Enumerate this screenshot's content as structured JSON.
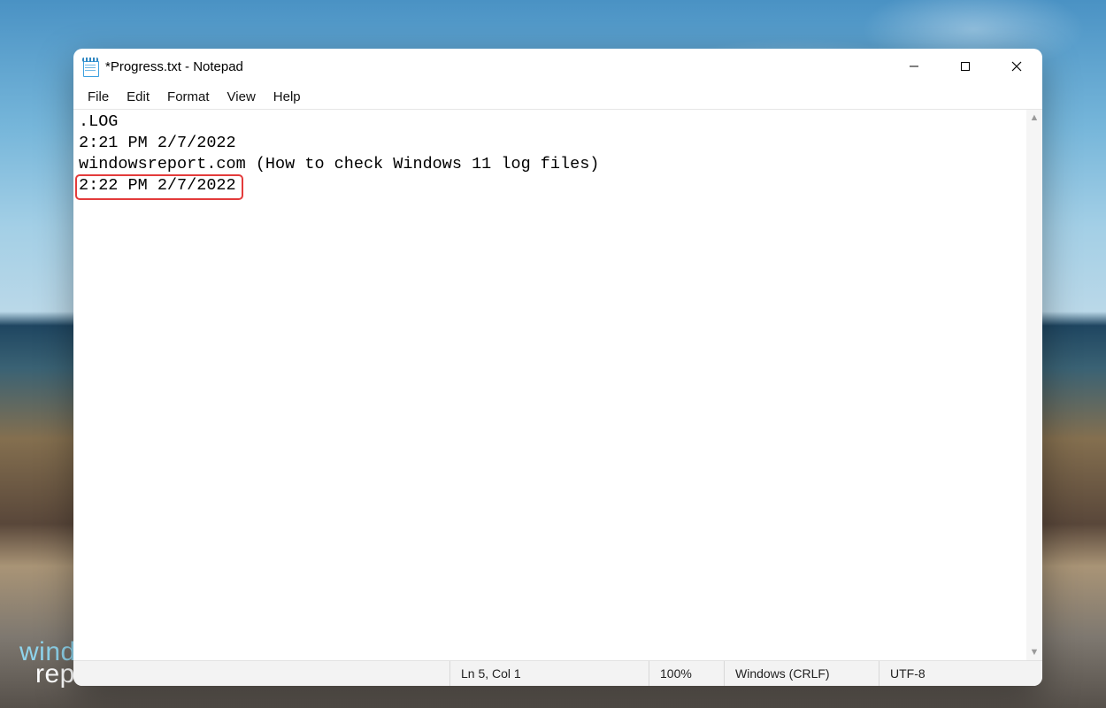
{
  "window": {
    "title": "*Progress.txt - Notepad"
  },
  "menubar": {
    "items": [
      "File",
      "Edit",
      "Format",
      "View",
      "Help"
    ]
  },
  "editor": {
    "lines": [
      ".LOG",
      "2:21 PM 2/7/2022",
      "windowsreport.com (How to check Windows 11 log files)",
      "2:22 PM 2/7/2022"
    ],
    "highlighted_line_index": 3
  },
  "statusbar": {
    "position": "Ln 5, Col 1",
    "zoom": "100%",
    "line_ending": "Windows (CRLF)",
    "encoding": "UTF-8"
  },
  "watermark": {
    "line1": "windows",
    "line2": "report"
  }
}
